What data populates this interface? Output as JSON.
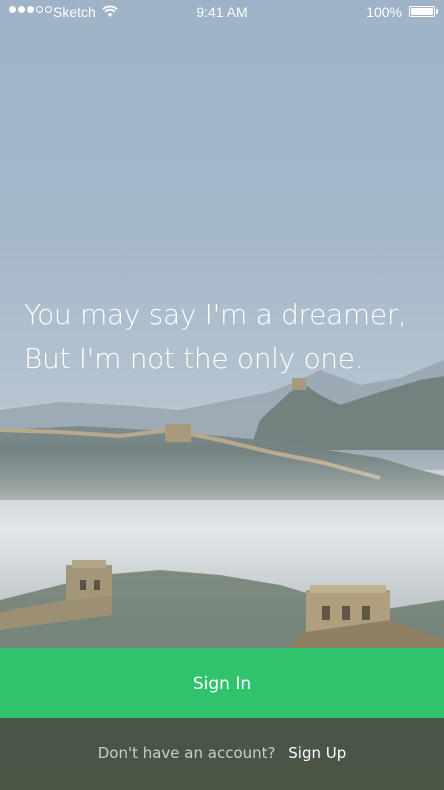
{
  "status_bar": {
    "carrier": "Sketch",
    "time": "9:41 AM",
    "battery": "100%",
    "signal_bars_filled": 3,
    "signal_bars_total": 5
  },
  "hero": {
    "line1": "You may say I'm a dreamer,",
    "line2": "But I'm not the only one."
  },
  "signin_button": {
    "label": "Sign In",
    "color": "#2fc36d"
  },
  "account_prompt": {
    "text": "Don't have an account?",
    "link": "Sign Up"
  }
}
